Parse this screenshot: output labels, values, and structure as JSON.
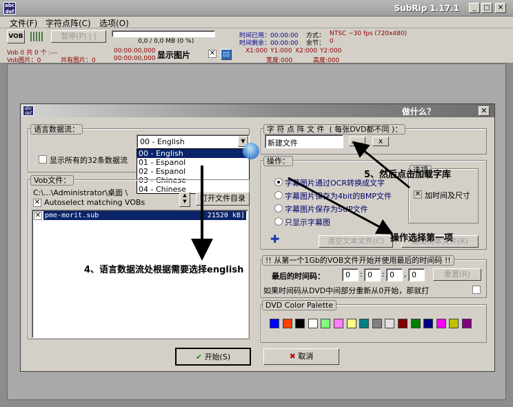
{
  "window": {
    "title": "SubRip 1.17.1",
    "icon_text": "abc def"
  },
  "menu": [
    "文件(F)",
    "字符点阵(C)",
    "选项(O)"
  ],
  "toolbar": {
    "vob_label": "VOB",
    "pause_label": "暂停(P) | |",
    "progress_text": "0,0 / 0,0 MB (0 %)",
    "time_used": "时间已用：00:00:00",
    "time_remaining": "时间剩余：00:00:00",
    "mode": "方式：",
    "mode_value": "NTSC ~30 fps (720x480)",
    "rest": "余节：",
    "rest_value": "0"
  },
  "infobar": {
    "vob_info": "Vob 0 共 0 个 :---",
    "vob_images": "Vob图片：0",
    "total_images": "共有图片：0",
    "time1": "00:00:00,000",
    "time2": "00:00:00,000",
    "show_image": "显示图片",
    "x1": "X1:000",
    "y1": "Y1:000",
    "x2": "X2:000",
    "y2": "Y2:000",
    "width": "宽度:000",
    "height": "高度:000"
  },
  "dialog": {
    "title": "做什么？",
    "lang_group": "语言数据流：",
    "lang_selected": "00 - English",
    "lang_options": [
      "00 - English",
      "01 - Espanol",
      "02 - Espanol",
      "03 - Chinese",
      "04 - Chinese"
    ],
    "show32": "显示所有的32条数据流",
    "vob_group": "Vob文件：",
    "vob_path": "C:\\...\\Administrator\\桌面 \\",
    "autoselect": "Autoselect matching VOBs",
    "open_dir": "打开文件目录",
    "vob_file": "pme-morit.sub",
    "vob_size": "[ 21520 kB]",
    "charfile_group": "字 符 点 阵 文 件",
    "charfile_note": "( 每张DVD都不同 )：",
    "charfile_value": "新建文件",
    "browse": ". . .",
    "clear": "x",
    "ops_group": "操作：",
    "ops": [
      "字幕图片通过OCR转换成文字",
      "字幕图片保存为4bit的BMP文件",
      "字幕图片保存为SUP文件",
      "只显示字幕图"
    ],
    "options_group": "选项",
    "add_time": "加时间及尺寸",
    "clear_text": "清空文本文件(C)",
    "load_text": "追加文本文件(R)",
    "timecode_group": "!! 从第一个1Gb的VOB文件开始并使用最后的时间码 !!",
    "last_timecode": "最后的时间码：",
    "tc": [
      "0",
      "0",
      "0",
      "0"
    ],
    "reset": "重置(R)",
    "restart_note": "如果时间码从DVD中间部分重新从0开始，那就打",
    "palette_group": "DVD Color Palette",
    "palette": [
      "#0000ff",
      "#ff4000",
      "#000000",
      "#ffffff",
      "#80ff80",
      "#ff80ff",
      "#ffff80",
      "#008080",
      "#808080",
      "#e0e0e0",
      "#800000",
      "#008000",
      "#000080",
      "#ff00ff",
      "#c0c000",
      "#800080"
    ],
    "start": "开始(S)",
    "cancel": "取消"
  },
  "annotations": {
    "a4": "4、语言数据流处根据需要选择english",
    "a5": "5、然后点击加载字库",
    "op": "操作选择第一项"
  }
}
